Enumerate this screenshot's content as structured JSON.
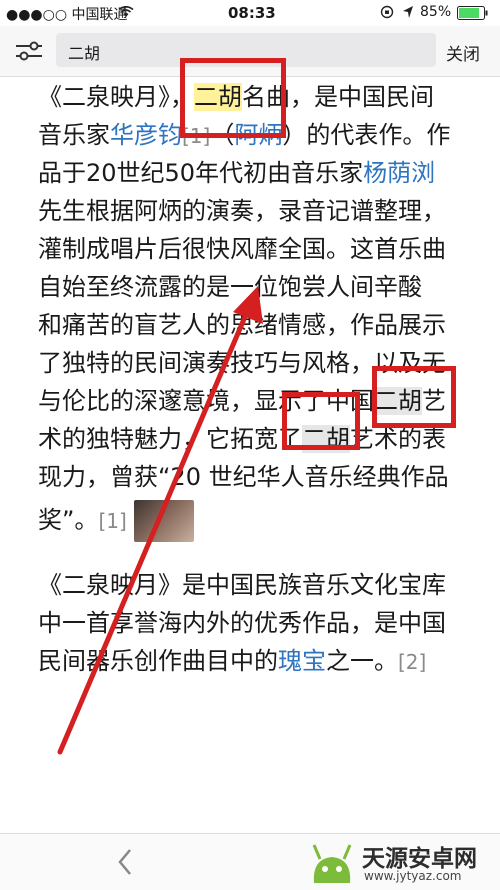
{
  "status_bar": {
    "carrier": "●●●○○ 中国联通",
    "time": "08:33",
    "battery_percent": "85%",
    "icons": [
      "wifi-icon",
      "orientation-lock-icon",
      "location-icon",
      "battery-icon"
    ]
  },
  "search_bar": {
    "query": "二胡",
    "close_label": "关闭"
  },
  "article": {
    "p1": {
      "l1": {
        "a": "《二泉映月》，",
        "hl": "二胡",
        "b": "名曲，是中国民间"
      },
      "l2": {
        "a": "音乐家",
        "link1": "华彦钧",
        "ref": "[1]",
        "b": "（",
        "link2": "阿炳",
        "c": "）的代表作。作"
      },
      "l3": {
        "a": "品于20世纪50年代初由音乐家",
        "link": "杨荫浏"
      },
      "l4": "先生根据阿炳的演奏，录音记谱整理，",
      "l5": "灌制成唱片后很快风靡全国。这首乐曲",
      "l6": "自始至终流露的是一位饱尝人间辛酸",
      "l7": "和痛苦的盲艺人的思绪情感，作品展示",
      "l8": "了独特的民间演奏技巧与风格，以及无",
      "l9": {
        "a": "与伦比的深邃意境，显示了中国",
        "hl": "二胡",
        "b": "艺"
      },
      "l10": {
        "a": "术的独特魅力，它拓宽了",
        "hl": "二胡",
        "b": "艺术的表"
      },
      "l11": "现力，曾获“20 世纪华人音乐经典作品",
      "l12": {
        "a": "奖”。",
        "ref": "[1]"
      }
    },
    "p2": {
      "l1": "《二泉映月》是中国民族音乐文化宝库",
      "l2": "中一首享誉海内外的优秀作品，是中国",
      "l3": {
        "a": "民间器乐创作曲目中的",
        "link": "瑰宝",
        "b": "之一。",
        "ref": "[2]"
      }
    }
  },
  "watermark": {
    "text": "天源安卓网",
    "url": "www.jytyaz.com"
  },
  "colors": {
    "annotation_red": "#d42020",
    "link_blue": "#2f74c0",
    "highlight_yellow": "#fff29a"
  }
}
